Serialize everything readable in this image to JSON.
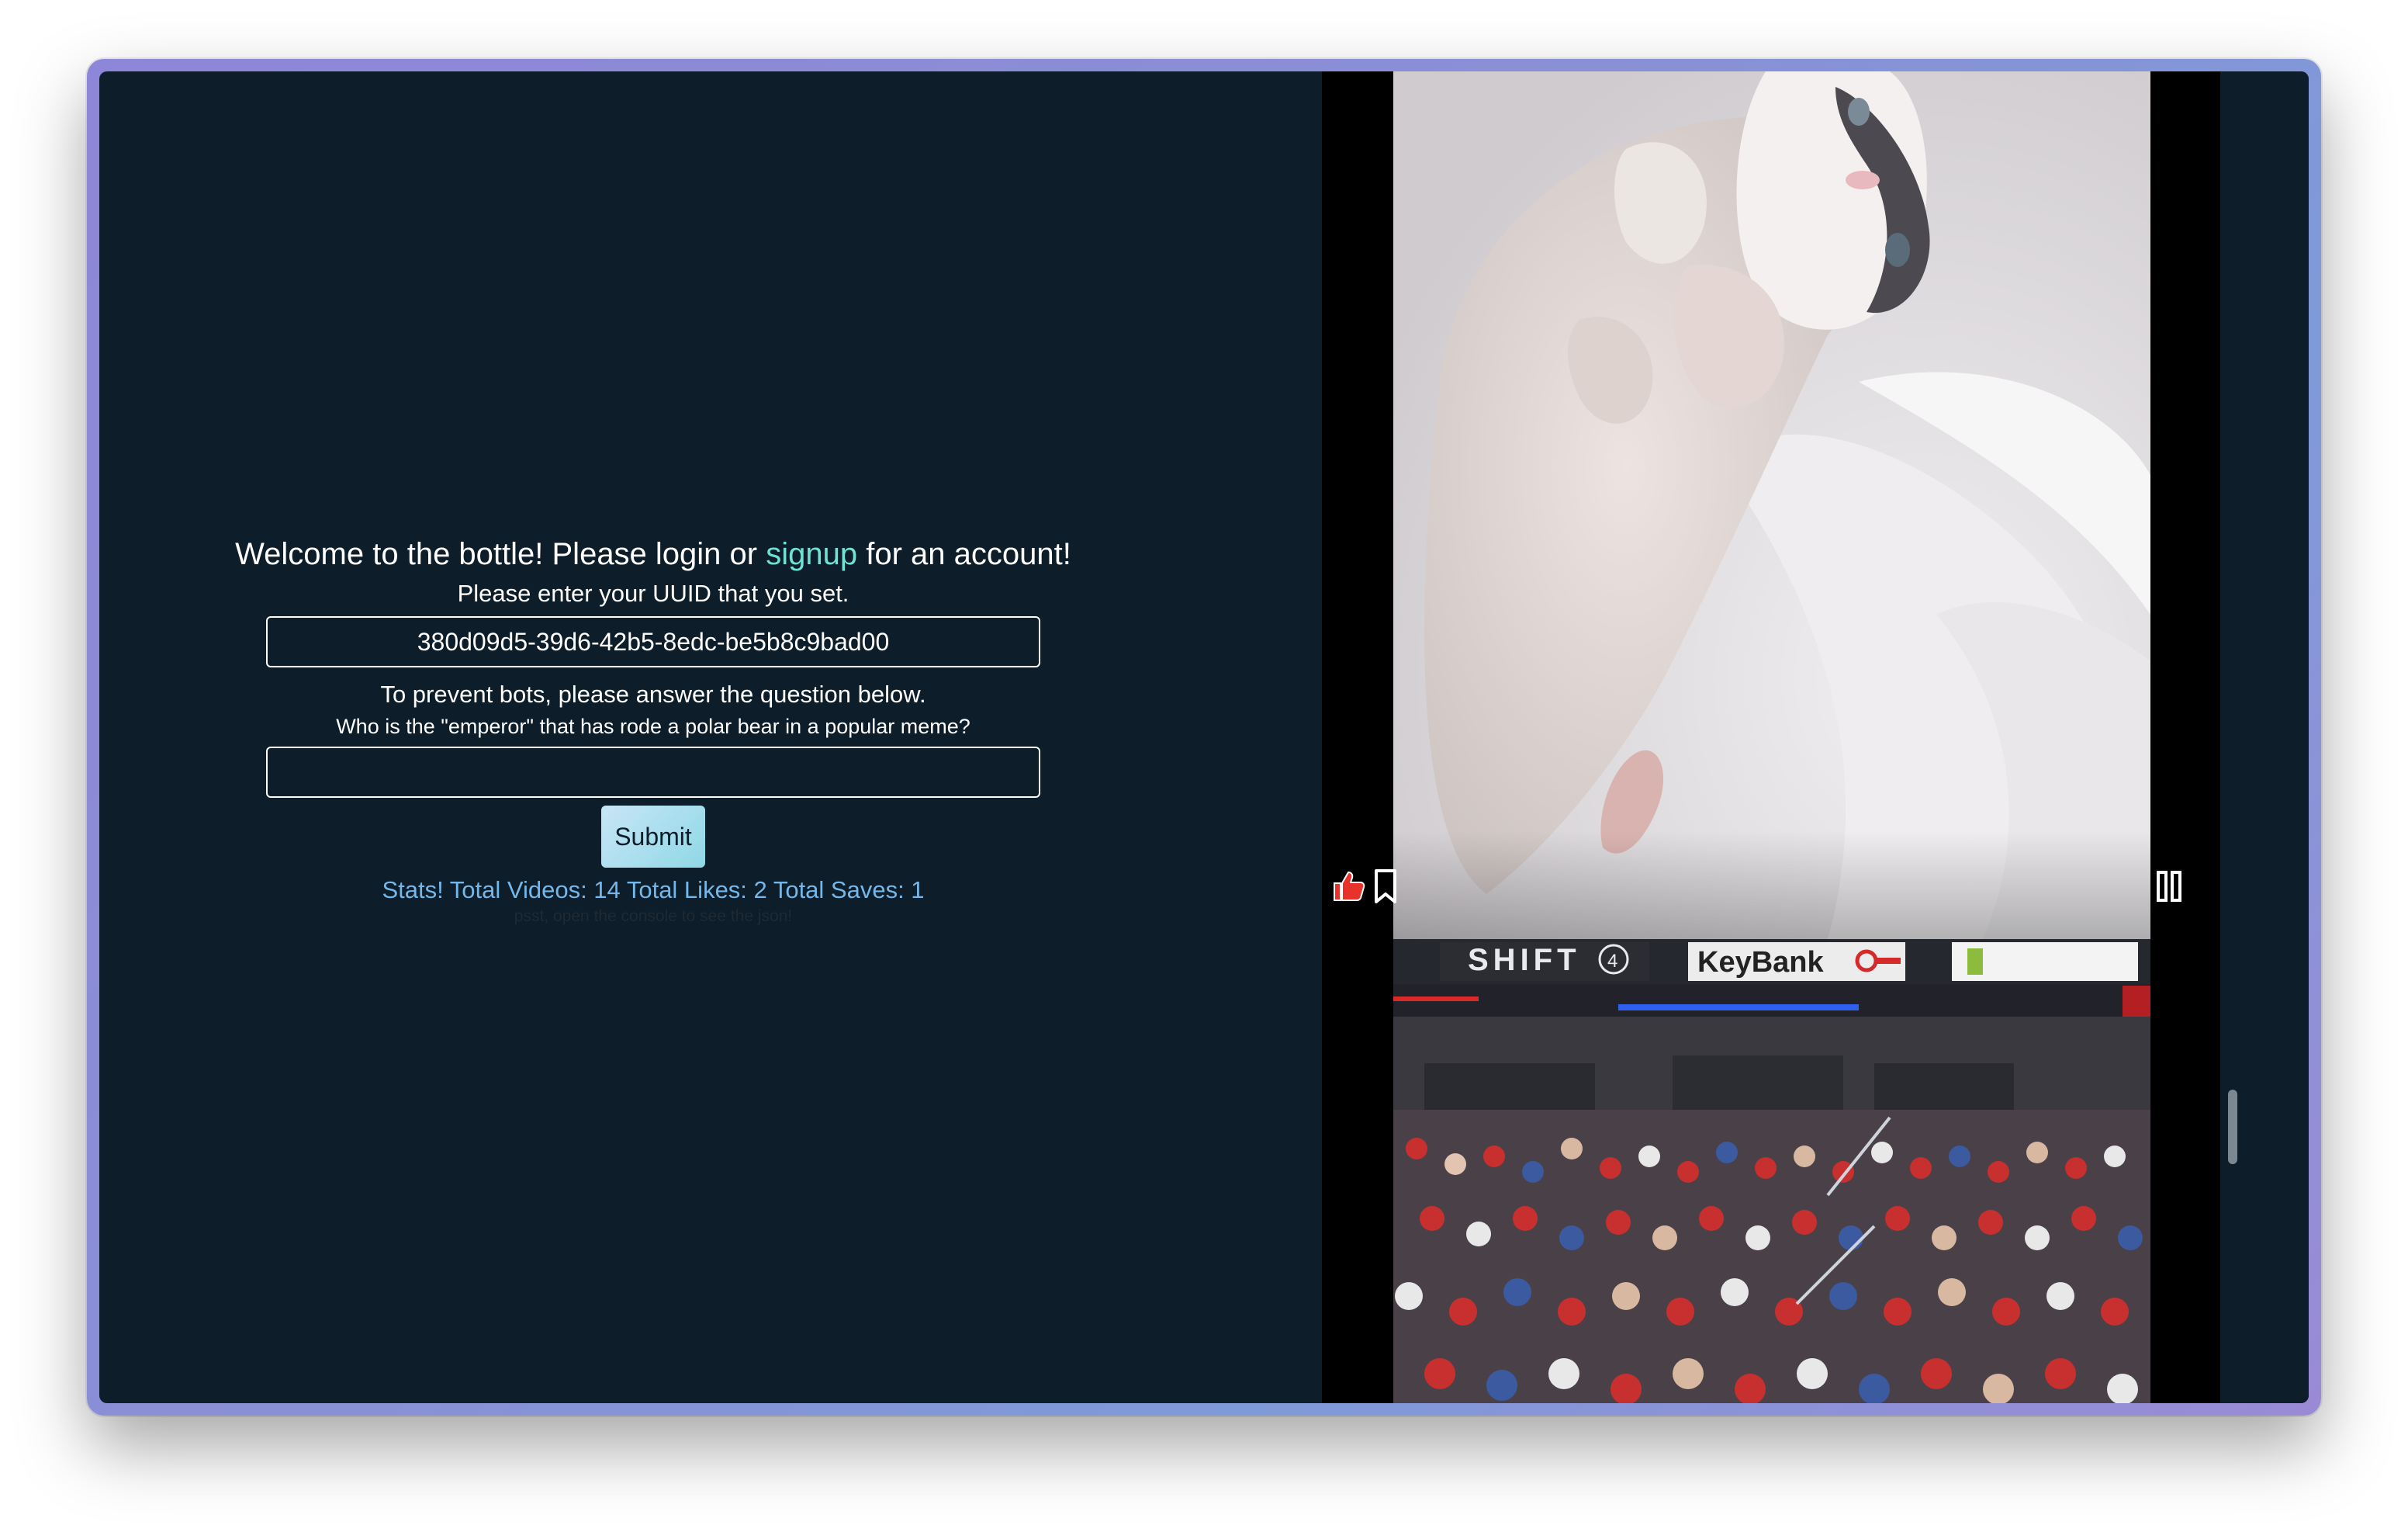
{
  "login": {
    "welcome_prefix": "Welcome to the bottle! Please login or ",
    "signup_link": "signup",
    "welcome_suffix": " for an account!",
    "uuid_label": "Please enter your UUID that you set.",
    "uuid_value": "380d09d5-39d6-42b5-8edc-be5b8c9bad00",
    "prevent_label": "To prevent bots, please answer the question below.",
    "question": "Who is the \"emperor\" that has rode a polar bear in a popular meme?",
    "answer_value": "",
    "submit_label": "Submit",
    "stats": "Stats! Total Videos: 14 Total Likes: 2 Total Saves: 1",
    "psst": "psst, open the console to see the json!"
  },
  "feed": {
    "videos": [
      {
        "subject": "white cat lying on a bed"
      },
      {
        "subject": "basketball arena crowd",
        "banners": [
          "SHIFT4",
          "KeyBank"
        ]
      }
    ],
    "controls": {
      "like_icon": "thumbs-up-icon",
      "save_icon": "bookmark-icon",
      "pause_icon": "pause-icon"
    }
  },
  "colors": {
    "background": "#0d1d29",
    "link": "#6fe2d3",
    "stats": "#74b7ea",
    "like": "#e8322c"
  }
}
